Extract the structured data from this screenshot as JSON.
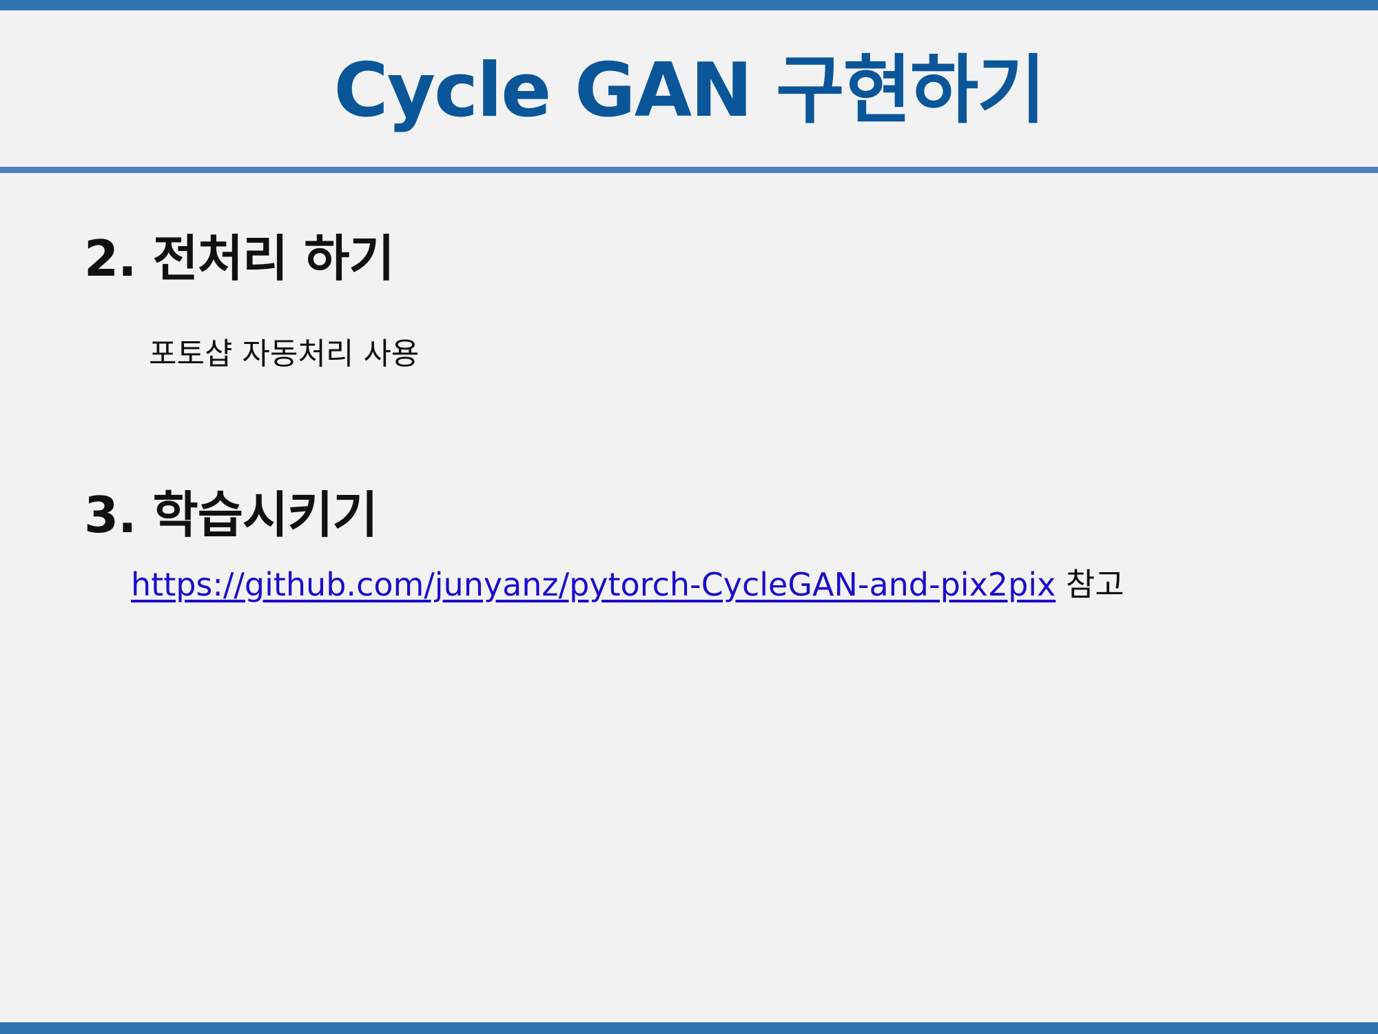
{
  "slide": {
    "title": "Cycle GAN 구현하기"
  },
  "sections": [
    {
      "heading": "2. 전처리 하기",
      "body": "포토샵 자동처리 사용"
    },
    {
      "heading": "3. 학습시키기",
      "link": "https://github.com/junyanz/pytorch-CycleGAN-and-pix2pix",
      "link_suffix": " 참고"
    }
  ],
  "colors": {
    "background": "#f2f2f2",
    "title": "#0a5699",
    "bars": "#2e75b0",
    "rule": "#4f81bd",
    "link": "#1a0dcc",
    "text": "#111111"
  }
}
